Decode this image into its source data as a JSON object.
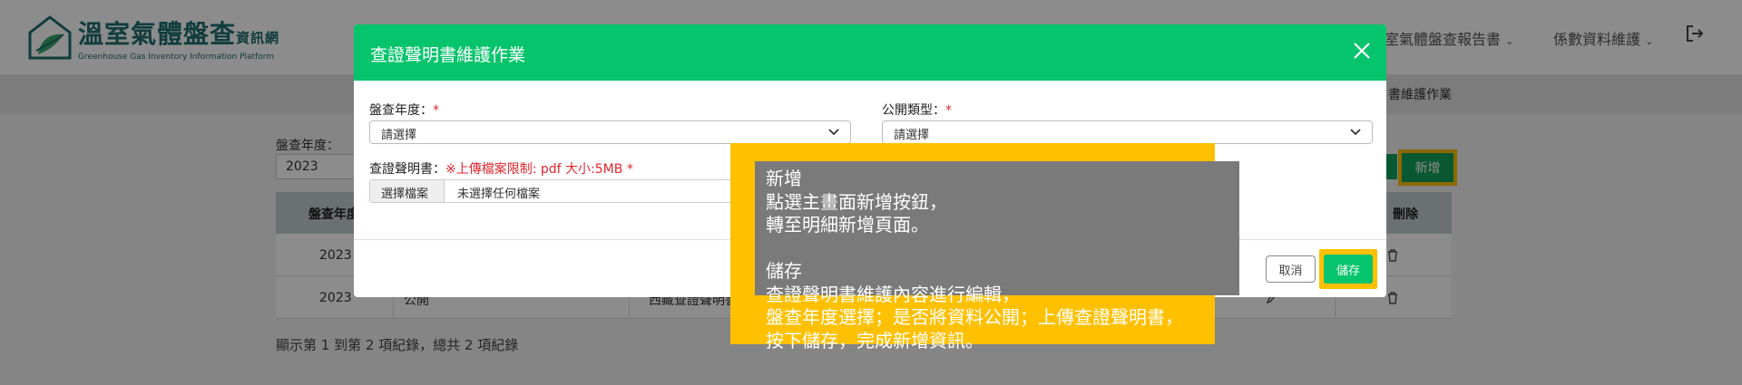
{
  "header": {
    "logo_title": "溫室氣體盤查",
    "logo_title_small": "資訊網",
    "logo_subtitle": "Greenhouse Gas Inventory Information Platform",
    "nav": [
      {
        "label": "溫室氣體盤查報告書"
      },
      {
        "label": "係數資料維護"
      }
    ],
    "breadcrumb": "書維護作業"
  },
  "filter": {
    "year_label": "盤查年度：",
    "year_value": "2023",
    "add_button": "新增"
  },
  "table": {
    "headers": [
      "盤查年度",
      "刪除"
    ],
    "rows": [
      {
        "year": "2023",
        "type": "",
        "file": ""
      },
      {
        "year": "2023",
        "type": "公開",
        "file": "西藏查證聲明書"
      }
    ]
  },
  "pagination_info": "顯示第 1 到第 2 項紀錄，總共 2 項紀錄",
  "modal": {
    "title": "查證聲明書維護作業",
    "year_label": "盤查年度：",
    "year_placeholder": "請選擇",
    "type_label": "公開類型：",
    "type_placeholder": "請選擇",
    "file_label": "查證聲明書：",
    "file_hint": "※上傳檔案限制: pdf 大小:5MB",
    "required_mark": "*",
    "file_button": "選擇檔案",
    "file_name": "未選擇任何檔案",
    "cancel_button": "取消",
    "save_button": "儲存"
  },
  "callout": {
    "text": "新增\n點選主畫面新增按鈕，\n轉至明細新增頁面。\n\n儲存\n查證聲明書維護內容進行編輯，\n盤查年度選擇；是否將資料公開；上傳查證聲明書，\n按下儲存，完成新增資訊。"
  },
  "colors": {
    "brand_green": "#06c46b",
    "dark_green": "#13a05a",
    "highlight": "#ffc000",
    "required_red": "#e0262d"
  },
  "icons": [
    "logo-icon",
    "chevron-down-icon",
    "logout-icon",
    "close-icon",
    "trash-icon",
    "pencil-icon"
  ]
}
